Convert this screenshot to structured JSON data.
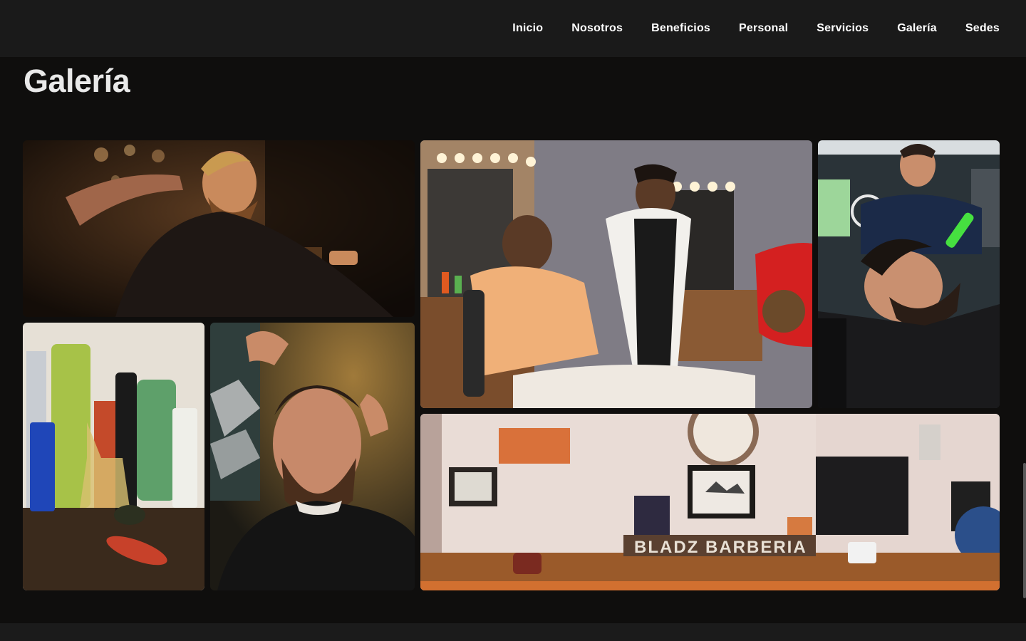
{
  "nav": {
    "items": [
      "Inicio",
      "Nosotros",
      "Beneficios",
      "Personal",
      "Servicios",
      "Galería",
      "Sedes"
    ]
  },
  "gallery": {
    "title": "Galería",
    "shop_sign": "BLADZ BARBERIA",
    "photos": [
      {
        "name": "barber-cutting-hair-dark-photo"
      },
      {
        "name": "barber-shaving-client-photo"
      },
      {
        "name": "beard-trim-razor-photo"
      },
      {
        "name": "barber-products-shelf-photo"
      },
      {
        "name": "bearded-man-haircut-photo"
      },
      {
        "name": "barbershop-interior-photo"
      }
    ]
  },
  "colors": {
    "background": "#0f0e0d",
    "topbar": "#1a1a1a",
    "title": "#e9e9e9"
  }
}
